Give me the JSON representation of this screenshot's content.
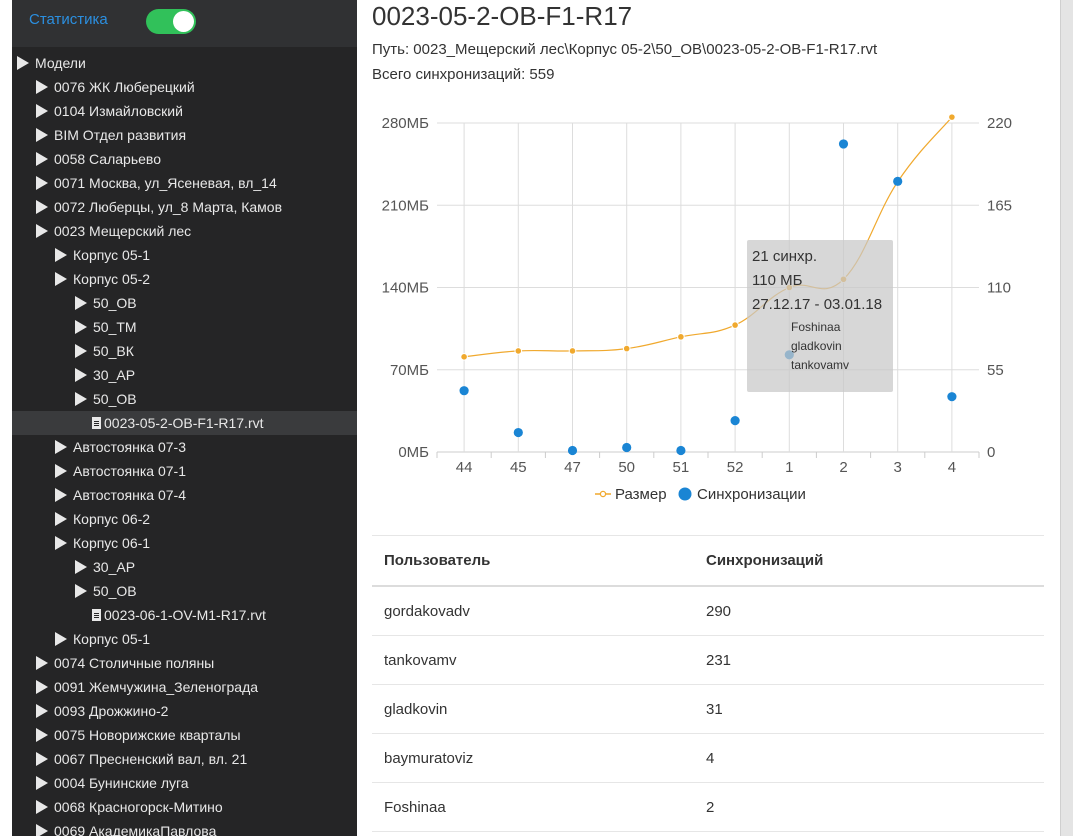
{
  "sidebar": {
    "stats_link": "Статистика",
    "toggle_label": "",
    "tree": [
      {
        "label": "Модели",
        "level": 0,
        "type": "folder"
      },
      {
        "label": "0076 ЖК Люберецкий",
        "level": 1,
        "type": "folder"
      },
      {
        "label": "0104 Измайловский",
        "level": 1,
        "type": "folder"
      },
      {
        "label": "BIM Отдел развития",
        "level": 1,
        "type": "folder"
      },
      {
        "label": "0058 Саларьево",
        "level": 1,
        "type": "folder"
      },
      {
        "label": "0071 Москва, ул_Ясеневая, вл_14",
        "level": 1,
        "type": "folder"
      },
      {
        "label": "0072 Люберцы, ул_8 Марта, Камов",
        "level": 1,
        "type": "folder"
      },
      {
        "label": "0023 Мещерский лес",
        "level": 1,
        "type": "folder"
      },
      {
        "label": "Корпус 05-1",
        "level": 2,
        "type": "folder"
      },
      {
        "label": "Корпус 05-2",
        "level": 2,
        "type": "folder"
      },
      {
        "label": "50_ОВ",
        "level": 3,
        "type": "folder"
      },
      {
        "label": "50_ТМ",
        "level": 3,
        "type": "folder"
      },
      {
        "label": "50_ВК",
        "level": 3,
        "type": "folder"
      },
      {
        "label": "30_АР",
        "level": 3,
        "type": "folder"
      },
      {
        "label": "50_ОВ",
        "level": 3,
        "type": "folder"
      },
      {
        "label": "0023-05-2-OB-F1-R17.rvt",
        "level": 4,
        "type": "file",
        "selected": true
      },
      {
        "label": "Автостоянка 07-3",
        "level": 2,
        "type": "folder"
      },
      {
        "label": "Автостоянка 07-1",
        "level": 2,
        "type": "folder"
      },
      {
        "label": "Автостоянка 07-4",
        "level": 2,
        "type": "folder"
      },
      {
        "label": "Корпус 06-2",
        "level": 2,
        "type": "folder"
      },
      {
        "label": "Корпус 06-1",
        "level": 2,
        "type": "folder"
      },
      {
        "label": "30_АР",
        "level": 3,
        "type": "folder"
      },
      {
        "label": "50_ОВ",
        "level": 3,
        "type": "folder"
      },
      {
        "label": "0023-06-1-OV-M1-R17.rvt",
        "level": 4,
        "type": "file"
      },
      {
        "label": "Корпус 05-1",
        "level": 2,
        "type": "folder"
      },
      {
        "label": "0074 Столичные поляны",
        "level": 1,
        "type": "folder"
      },
      {
        "label": "0091 Жемчужина_Зеленограда",
        "level": 1,
        "type": "folder"
      },
      {
        "label": "0093 Дрожжино-2",
        "level": 1,
        "type": "folder"
      },
      {
        "label": "0075 Новорижские кварталы",
        "level": 1,
        "type": "folder"
      },
      {
        "label": "0067 Пресненский вал, вл. 21",
        "level": 1,
        "type": "folder"
      },
      {
        "label": "0004 Бунинские луга",
        "level": 1,
        "type": "folder"
      },
      {
        "label": "0068 Красногорск-Митино",
        "level": 1,
        "type": "folder"
      },
      {
        "label": "0069 АкадемикаПавлова",
        "level": 1,
        "type": "folder"
      }
    ]
  },
  "main": {
    "title": "0023-05-2-OB-F1-R17",
    "path": "Путь: 0023_Мещерский лес\\Корпус 05-2\\50_ОВ\\0023-05-2-OB-F1-R17.rvt",
    "total_syncs": "Всего синхронизаций: 559"
  },
  "colors": {
    "size_line": "#f0a92e",
    "sync_dots": "#1a85d4",
    "toggle_on": "#31c15a",
    "link": "#2b8fe0"
  },
  "chart_data": {
    "type": "line",
    "categories": [
      "44",
      "45",
      "47",
      "50",
      "51",
      "52",
      "1",
      "2",
      "3",
      "4"
    ],
    "series": [
      {
        "name": "Размер",
        "axis": "left",
        "kind": "line",
        "unit": "МБ",
        "values": [
          81,
          86,
          86,
          88,
          98,
          108,
          140,
          147,
          230,
          285
        ]
      },
      {
        "name": "Синхронизации",
        "axis": "right",
        "kind": "scatter",
        "values": [
          41,
          13,
          1,
          3,
          1,
          21,
          65,
          206,
          181,
          37
        ]
      }
    ],
    "y_left": {
      "range": [
        0,
        280
      ],
      "ticks": [
        "0МБ",
        "70МБ",
        "140МБ",
        "210МБ",
        "280МБ"
      ]
    },
    "y_right": {
      "range": [
        0,
        220
      ],
      "ticks": [
        "0",
        "55",
        "110",
        "165",
        "220"
      ]
    },
    "grid": true,
    "legend_position": "bottom",
    "tooltip": {
      "category": "1",
      "lines": [
        "21 синхр.",
        "110 МБ",
        "27.12.17 - 03.01.18"
      ],
      "users": [
        "Foshinaa",
        "gladkovin",
        "tankovamv"
      ]
    }
  },
  "table": {
    "headers": [
      "Пользователь",
      "Синхронизаций"
    ],
    "rows": [
      [
        "gordakovadv",
        "290"
      ],
      [
        "tankovamv",
        "231"
      ],
      [
        "gladkovin",
        "31"
      ],
      [
        "baymuratoviz",
        "4"
      ],
      [
        "Foshinaa",
        "2"
      ]
    ]
  }
}
